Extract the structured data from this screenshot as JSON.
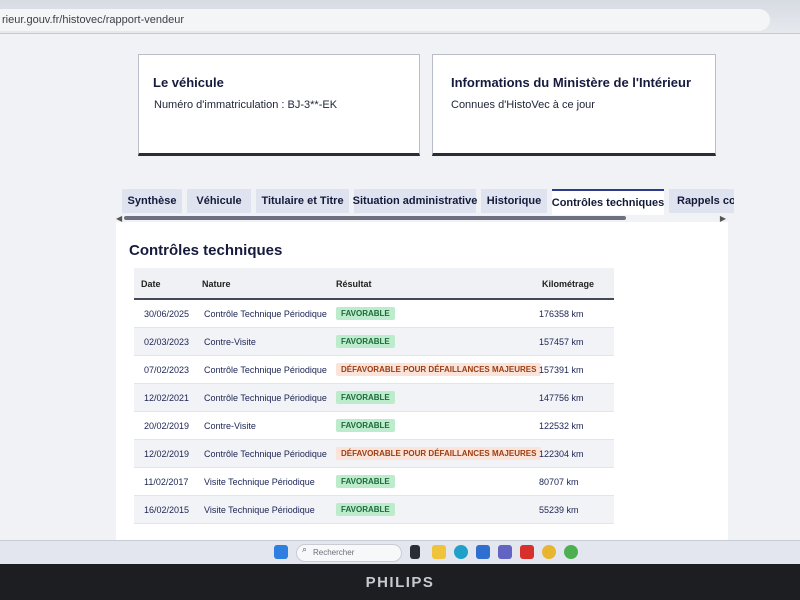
{
  "browser": {
    "url": "rieur.gouv.fr/histovec/rapport-vendeur"
  },
  "vehicle_card": {
    "title": "Le véhicule",
    "plate_text": "Numéro d'immatriculation : BJ-3**-EK"
  },
  "ministry_card": {
    "title": "Informations du Ministère de l'Intérieur",
    "subtitle": "Connues d'HistoVec à ce jour"
  },
  "tabs": [
    {
      "label": "Synthèse"
    },
    {
      "label": "Véhicule"
    },
    {
      "label": "Titulaire et Titre"
    },
    {
      "label": "Situation administrative"
    },
    {
      "label": "Historique"
    },
    {
      "label": "Contrôles techniques",
      "active": true
    },
    {
      "label": "Rappels constructeur"
    }
  ],
  "section": {
    "title": "Contrôles techniques"
  },
  "table": {
    "headers": {
      "date": "Date",
      "nature": "Nature",
      "result": "Résultat",
      "mileage": "Kilométrage"
    },
    "rows": [
      {
        "date": "30/06/2025",
        "nature": "Contrôle Technique Périodique",
        "result": "FAVORABLE",
        "status": "favorable",
        "km": "176358 km"
      },
      {
        "date": "02/03/2023",
        "nature": "Contre-Visite",
        "result": "FAVORABLE",
        "status": "favorable",
        "km": "157457 km"
      },
      {
        "date": "07/02/2023",
        "nature": "Contrôle Technique Périodique",
        "result": "DÉFAVORABLE POUR DÉFAILLANCES MAJEURES",
        "status": "defavorable",
        "km": "157391 km"
      },
      {
        "date": "12/02/2021",
        "nature": "Contrôle Technique Périodique",
        "result": "FAVORABLE",
        "status": "favorable",
        "km": "147756 km"
      },
      {
        "date": "20/02/2019",
        "nature": "Contre-Visite",
        "result": "FAVORABLE",
        "status": "favorable",
        "km": "122532 km"
      },
      {
        "date": "12/02/2019",
        "nature": "Contrôle Technique Périodique",
        "result": "DÉFAVORABLE POUR DÉFAILLANCES MAJEURES",
        "status": "defavorable",
        "km": "122304 km"
      },
      {
        "date": "11/02/2017",
        "nature": "Visite Technique Périodique",
        "result": "FAVORABLE",
        "status": "favorable",
        "km": "80707 km"
      },
      {
        "date": "16/02/2015",
        "nature": "Visite Technique Périodique",
        "result": "FAVORABLE",
        "status": "favorable",
        "km": "55239 km"
      }
    ]
  },
  "taskbar": {
    "search_placeholder": "Rechercher",
    "icons": [
      "windows-start-icon",
      "search-icon",
      "task-view-icon",
      "file-explorer-icon",
      "edge-icon",
      "store-icon",
      "teams-icon",
      "app-l-icon",
      "chrome-icon",
      "chrome-profile-icon"
    ]
  },
  "monitor": {
    "brand": "PHILIPS"
  },
  "colors": {
    "accent": "#2b3a8a",
    "favorable_bg": "#bdeccd",
    "defavorable_bg": "#fbe3d9"
  }
}
